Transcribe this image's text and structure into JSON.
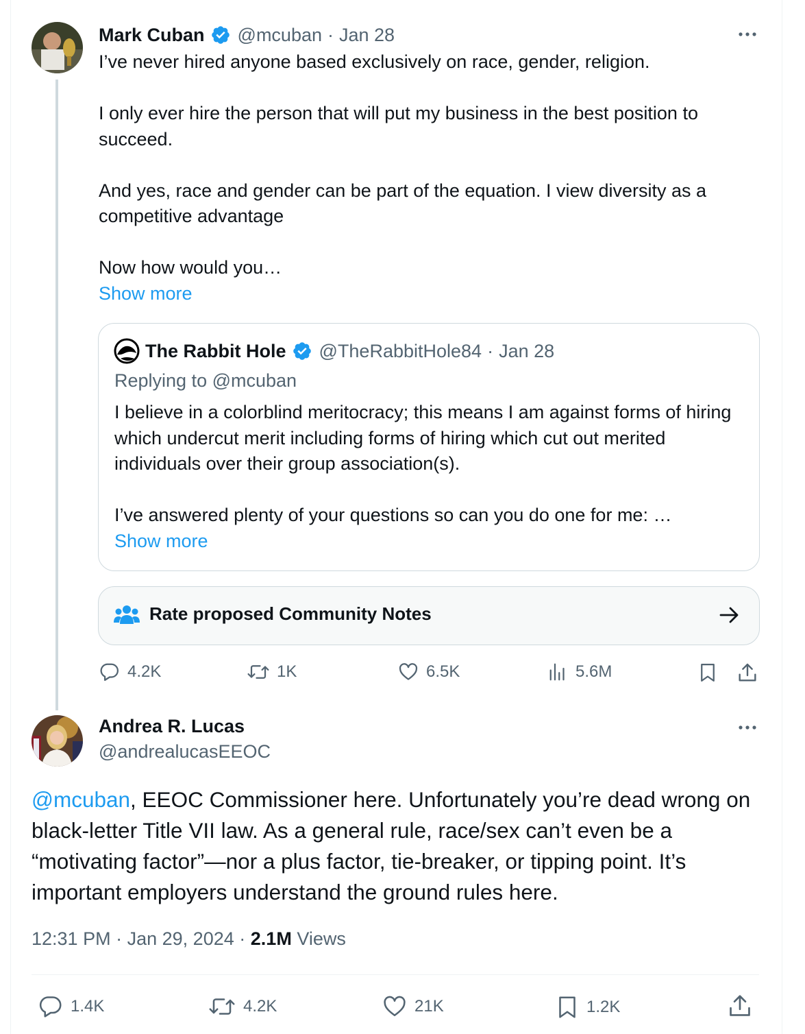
{
  "tweet1": {
    "name": "Mark Cuban",
    "handle": "@mcuban",
    "sep": "·",
    "date": "Jan 28",
    "paragraphs": [
      "I’ve never hired anyone based exclusively on race, gender, religion.",
      "I only ever hire the person that will put my business in the best position to succeed.",
      "And yes, race and gender can be part of the equation. I view diversity as a competitive advantage",
      "Now how would you…"
    ],
    "show_more": "Show more",
    "quote": {
      "name": "The Rabbit Hole",
      "handle": "@TheRabbitHole84",
      "sep": "·",
      "date": "Jan 28",
      "replying_to": "Replying to @mcuban",
      "paragraphs": [
        "I believe in a colorblind meritocracy; this means I am against forms of hiring which undercut merit including forms of hiring which cut out merited individuals over their group association(s).",
        "I’ve answered plenty of your questions so can you do one for me: …"
      ],
      "show_more": "Show more"
    },
    "community_notes": "Rate proposed Community Notes",
    "actions": {
      "replies": "4.2K",
      "reposts": "1K",
      "likes": "6.5K",
      "views": "5.6M"
    }
  },
  "tweet2": {
    "name": "Andrea R. Lucas",
    "handle": "@andrealucasEEOC",
    "mention": "@mcuban",
    "text": ", EEOC Commissioner here. Unfortunately you’re dead wrong on black-letter Title VII law. As a general rule, race/sex can’t even be a “motivating factor”—nor a plus factor, tie-breaker, or tipping point.  It’s important employers understand the ground rules here.",
    "time": "12:31 PM",
    "sep": "·",
    "date": "Jan 29, 2024",
    "sep2": "·",
    "views_count": "2.1M",
    "views_label": "Views",
    "actions": {
      "replies": "1.4K",
      "reposts": "4.2K",
      "likes": "21K",
      "bookmarks": "1.2K"
    }
  },
  "colors": {
    "accent": "#1d9bf0",
    "muted": "#536471",
    "border": "#cfd9de",
    "verified": "#1d9bf0"
  },
  "icons": [
    "more-icon",
    "verified-badge-icon",
    "community-notes-icon",
    "arrow-right-icon",
    "reply-icon",
    "repost-icon",
    "like-icon",
    "views-icon",
    "bookmark-icon",
    "share-icon"
  ]
}
